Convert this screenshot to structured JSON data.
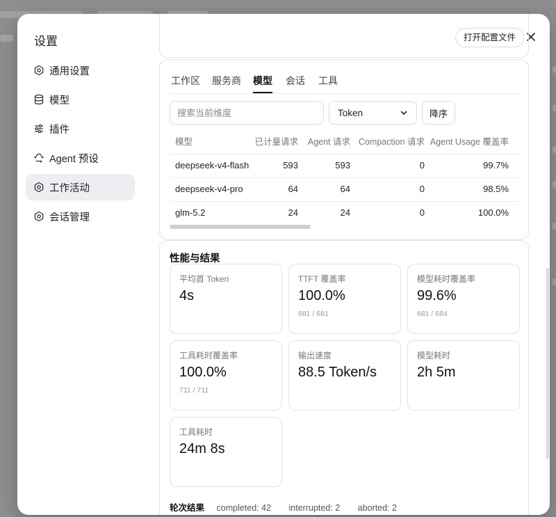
{
  "dialog": {
    "title": "设置",
    "open_config_label": "打开配置文件"
  },
  "sidebar": {
    "items": [
      {
        "label": "通用设置",
        "icon": "gear-icon"
      },
      {
        "label": "模型",
        "icon": "database-icon"
      },
      {
        "label": "插件",
        "icon": "sliders-icon"
      },
      {
        "label": "Agent 预设",
        "icon": "recycle-icon"
      },
      {
        "label": "工作活动",
        "icon": "gear-icon"
      },
      {
        "label": "会话管理",
        "icon": "gear-icon"
      }
    ],
    "active_index": 4
  },
  "tabs": {
    "items": [
      "工作区",
      "服务商",
      "模型",
      "会话",
      "工具"
    ],
    "active_index": 2
  },
  "filters": {
    "search_placeholder": "搜索当前维度",
    "metric_select": "Token",
    "sort_label": "降序"
  },
  "model_table": {
    "headers": [
      "模型",
      "已计量请求",
      "Agent 请求",
      "Compaction 请求",
      "Agent Usage 覆盖率"
    ],
    "rows": [
      [
        "deepseek-v4-flash",
        "593",
        "593",
        "0",
        "99.7%"
      ],
      [
        "deepseek-v4-pro",
        "64",
        "64",
        "0",
        "98.5%"
      ],
      [
        "glm-5.2",
        "24",
        "24",
        "0",
        "100.0%"
      ]
    ]
  },
  "performance": {
    "title": "性能与结果",
    "cards": [
      {
        "label": "平均首 Token",
        "value": "4s",
        "sub": ""
      },
      {
        "label": "TTFT 覆盖率",
        "value": "100.0%",
        "sub": "681 / 681"
      },
      {
        "label": "模型耗时覆盖率",
        "value": "99.6%",
        "sub": "681 / 684"
      },
      {
        "label": "工具耗时覆盖率",
        "value": "100.0%",
        "sub": "711 / 711"
      },
      {
        "label": "输出速度",
        "value": "88.5 Token/s",
        "sub": ""
      },
      {
        "label": "模型耗时",
        "value": "2h 5m",
        "sub": ""
      },
      {
        "label": "工具耗时",
        "value": "24m 8s",
        "sub": ""
      }
    ]
  },
  "rounds": {
    "title": "轮次结果",
    "items": [
      "completed: 42",
      "interrupted: 2",
      "aborted: 2"
    ]
  }
}
